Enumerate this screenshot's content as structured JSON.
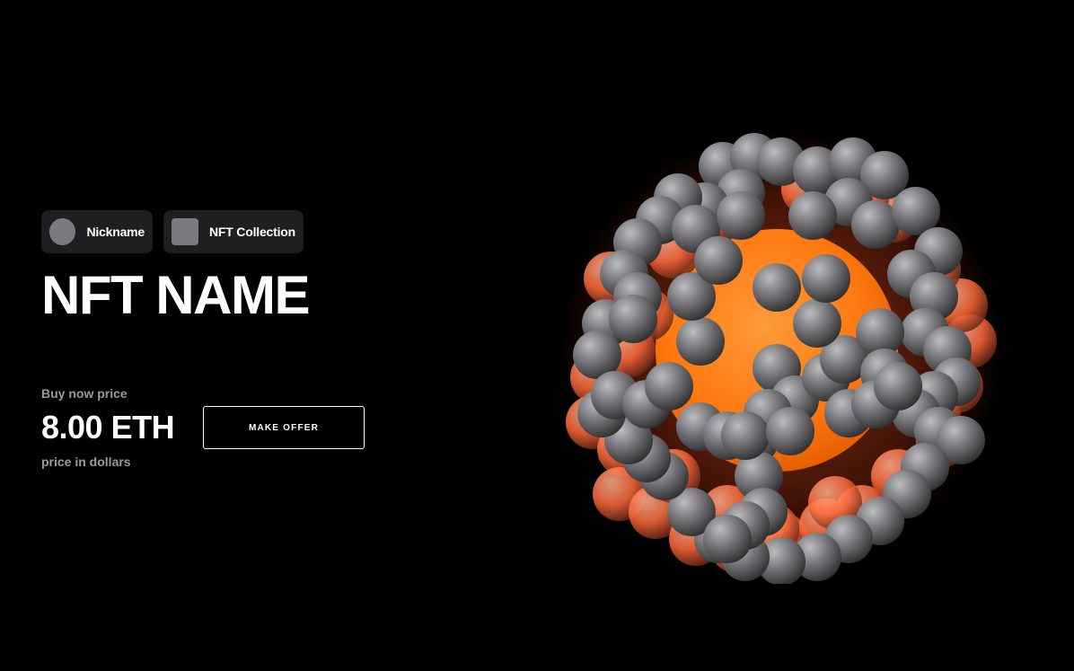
{
  "owner": {
    "nickname": "Nickname",
    "avatar_icon": "user-avatar-circle"
  },
  "collection": {
    "name": "NFT Collection",
    "thumbnail_icon": "collection-thumbnail-square"
  },
  "nft": {
    "name": "NFT NAME"
  },
  "pricing": {
    "buy_now_label": "Buy now price",
    "price": "8.00 ETH",
    "usd_label": "price in dollars",
    "make_offer_label": "MAKE OFFER"
  },
  "artwork": {
    "description_icon": "nft-sphere-artwork",
    "core_color": "#ff7a10",
    "bead_color": "#6a6a6e",
    "background": "#000000"
  }
}
